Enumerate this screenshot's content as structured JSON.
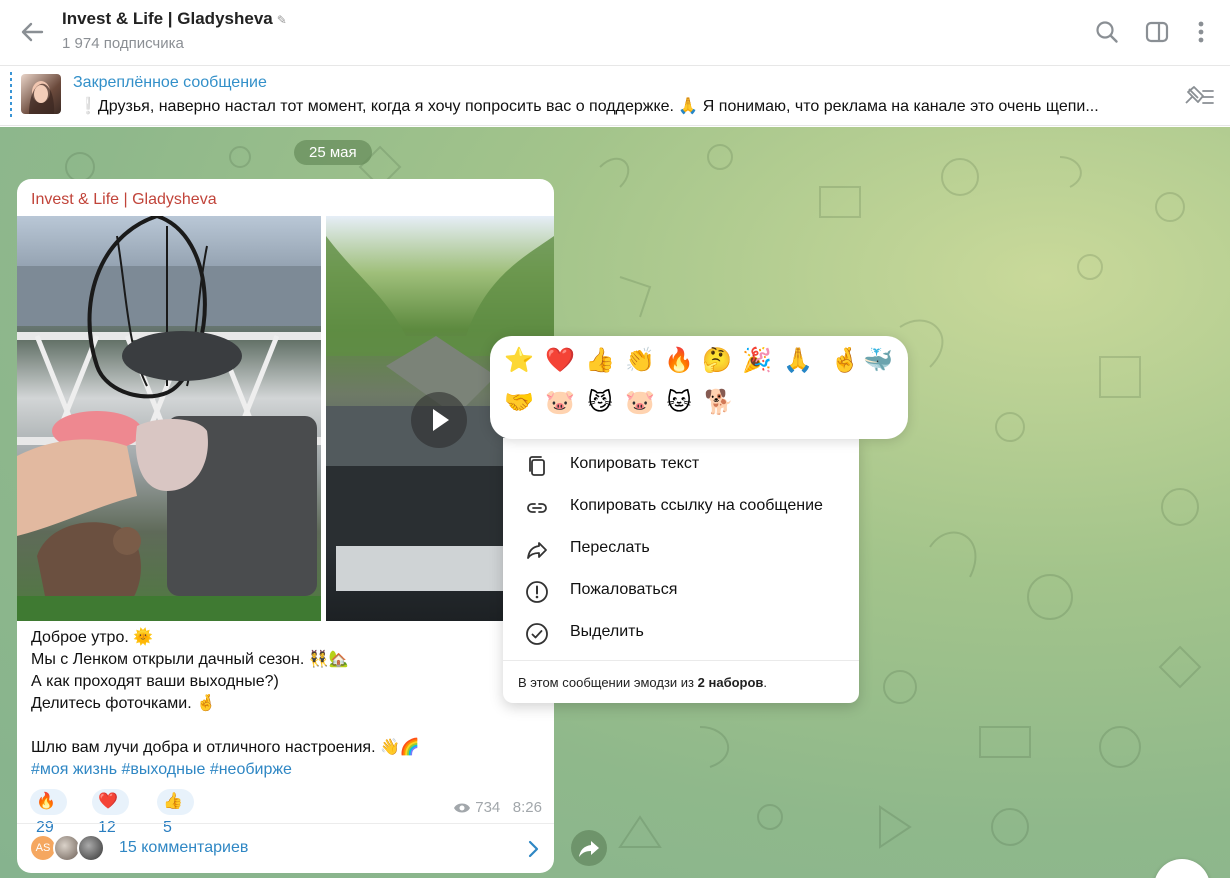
{
  "header": {
    "channel_title": "Invest & Life | Gladysheva",
    "subscribers": "1 974 подписчика"
  },
  "pinned": {
    "title": "Закреплённое сообщение",
    "text": "❕Друзья, наверно настал тот момент, когда я хочу попросить вас о поддержке. 🙏 Я понимаю, что реклама на канале это очень щепи..."
  },
  "chat": {
    "date_label": "25 мая"
  },
  "message": {
    "sender": "Invest & Life | Gladysheva",
    "lines": [
      "Доброе утро. 🌞",
      "Мы с Ленком открыли дачный сезон. 👯🏡",
      "А как проходят ваши выходные?)",
      "Делитесь фоточками. 🤞",
      "",
      "Шлю вам лучи добра и отличного настроения. 👋🌈"
    ],
    "hashtags": [
      "#моя жизнь",
      "#выходные",
      "#необирже"
    ],
    "reactions": [
      {
        "emoji": "🔥",
        "count": "29"
      },
      {
        "emoji": "❤️",
        "count": "12"
      },
      {
        "emoji": "👍",
        "count": "5"
      }
    ],
    "views": "734",
    "time": "8:26",
    "comments": {
      "avatar_initials": "AS",
      "label": "15 комментариев"
    }
  },
  "reaction_picker": {
    "emojis": [
      "⭐",
      "❤️",
      "👍",
      "👏",
      "🔥",
      "🤔",
      "🎉",
      "🙏",
      "🤞",
      "🐳",
      "🤝",
      "🐷",
      "😼",
      "🐷",
      "🐱",
      "🐕"
    ]
  },
  "context_menu": {
    "items": [
      {
        "label": "Копировать текст",
        "icon": "copy-icon"
      },
      {
        "label": "Копировать ссылку на сообщение",
        "icon": "link-icon"
      },
      {
        "label": "Переслать",
        "icon": "forward-icon"
      },
      {
        "label": "Пожаловаться",
        "icon": "report-icon"
      },
      {
        "label": "Выделить",
        "icon": "select-icon"
      }
    ],
    "footer_prefix": "В этом сообщении эмодзи из ",
    "footer_bold": "2 наборов",
    "footer_suffix": "."
  },
  "colors": {
    "accent": "#2f87c4",
    "sender": "#c1443a",
    "reaction_bg": "#e8f2fb"
  }
}
